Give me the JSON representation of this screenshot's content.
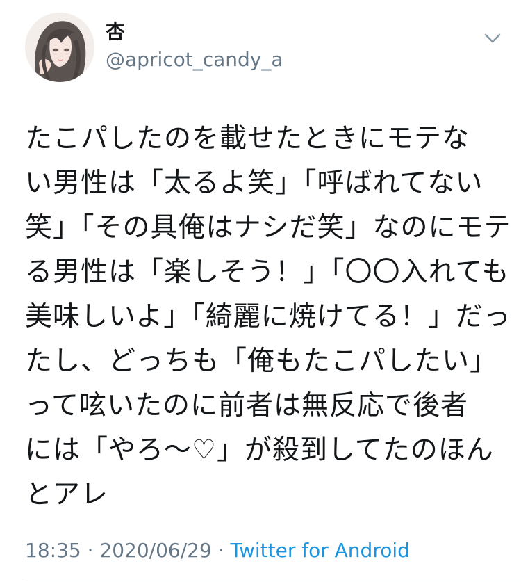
{
  "user": {
    "display_name": "杏",
    "handle": "@apricot_candy_a"
  },
  "tweet": {
    "lines": [
      "たこパしたのを載せたときにモテな",
      "い男性は「太るよ笑」「呼ばれてない",
      "笑」「その具俺はナシだ笑」なのにモテ",
      "る男性は「楽しそう！」「〇〇入れても",
      "美味しいよ」「綺麗に焼けてる！」だっ",
      "たし、どっちも「俺もたこパしたい」",
      "って呟いたのに前者は無反応で後者",
      "には「やろ〜♡」が殺到してたのほん",
      "とアレ"
    ],
    "time": "18:35",
    "separator_1": " · ",
    "date": "2020/06/29",
    "separator_2": " · ",
    "source": "Twitter for Android"
  },
  "icons": {
    "avatar": "profile-avatar",
    "menu": "chevron-down-icon"
  },
  "colors": {
    "text": "#14171a",
    "secondary": "#657786",
    "link": "#1b95e0",
    "divider": "#e1e8ed"
  }
}
